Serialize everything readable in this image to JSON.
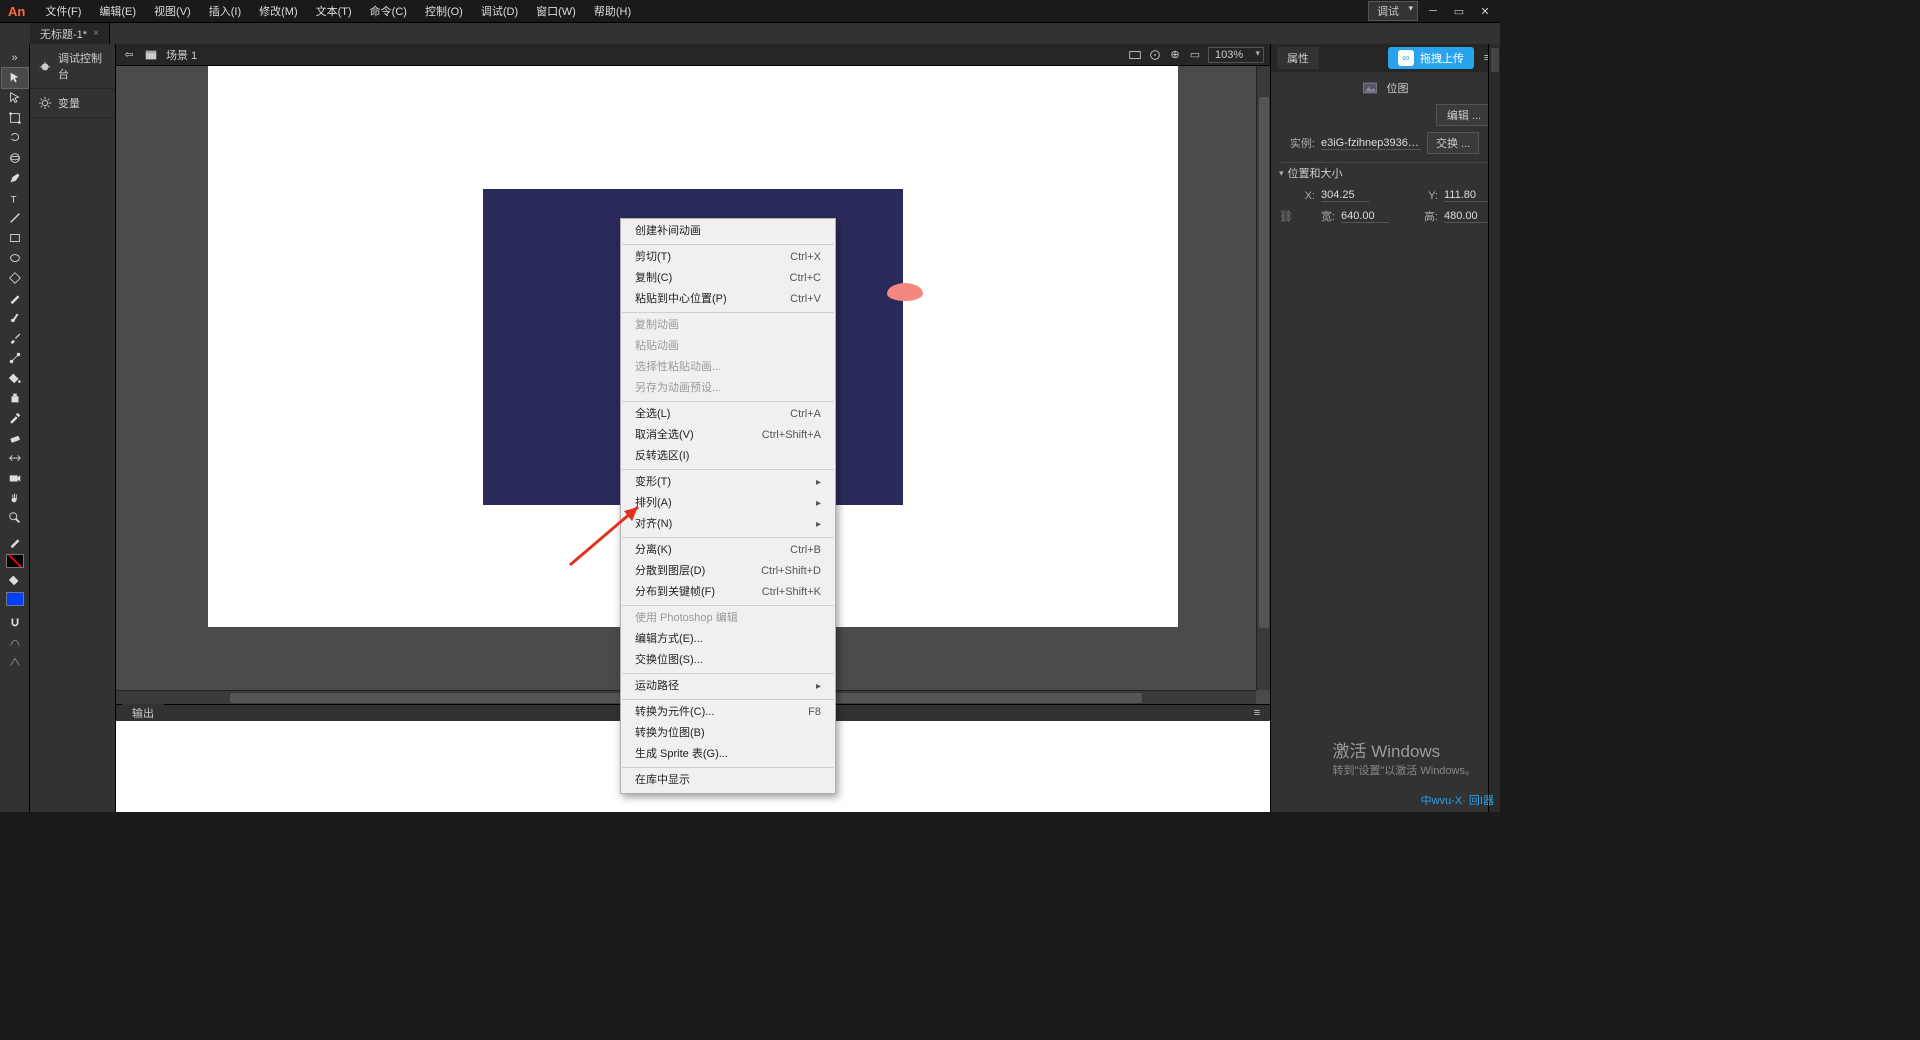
{
  "app": {
    "logo": "An"
  },
  "menus": [
    "文件(F)",
    "编辑(E)",
    "视图(V)",
    "插入(I)",
    "修改(M)",
    "文本(T)",
    "命令(C)",
    "控制(O)",
    "调试(D)",
    "窗口(W)",
    "帮助(H)"
  ],
  "titlebar": {
    "debug_label": "调试"
  },
  "doc_tab": {
    "title": "无标题-1*",
    "close": "×"
  },
  "left_dock": {
    "debug_console": "调试控制台",
    "vars": "变量"
  },
  "scene": {
    "label": "场景 1",
    "zoom": "103%"
  },
  "output": {
    "tab": "输出"
  },
  "context_menu": {
    "create_tween": "创建补间动画",
    "cut": "剪切(T)",
    "cut_sc": "Ctrl+X",
    "copy": "复制(C)",
    "copy_sc": "Ctrl+C",
    "paste_center": "粘贴到中心位置(P)",
    "paste_center_sc": "Ctrl+V",
    "copy_anim": "复制动画",
    "paste_anim": "粘贴动画",
    "paste_anim_sel": "选择性粘贴动画...",
    "save_preset": "另存为动画预设...",
    "select_all": "全选(L)",
    "select_all_sc": "Ctrl+A",
    "deselect": "取消全选(V)",
    "deselect_sc": "Ctrl+Shift+A",
    "invert_sel": "反转选区(I)",
    "transform": "变形(T)",
    "arrange": "排列(A)",
    "align": "对齐(N)",
    "break": "分离(K)",
    "break_sc": "Ctrl+B",
    "dist_layers": "分散到图层(D)",
    "dist_layers_sc": "Ctrl+Shift+D",
    "dist_keys": "分布到关键帧(F)",
    "dist_keys_sc": "Ctrl+Shift+K",
    "edit_ps": "使用 Photoshop 编辑",
    "edit_mode": "编辑方式(E)...",
    "swap_bitmap": "交换位图(S)...",
    "motion_path": "运动路径",
    "convert_symbol": "转换为元件(C)...",
    "convert_symbol_sc": "F8",
    "convert_bitmap": "转换为位图(B)",
    "generate_sprite": "生成 Sprite 表(G)...",
    "show_in_lib": "在库中显示"
  },
  "props": {
    "tab": "属性",
    "upload_btn": "拖拽上传",
    "kind": "位图",
    "edit_btn": "编辑 ...",
    "instance_lbl": "实例:",
    "instance_name": "e3iG-fzihnep39366...",
    "swap_btn": "交换 ...",
    "section_possize": "位置和大小",
    "x_lbl": "X:",
    "x_val": "304.25",
    "y_lbl": "Y:",
    "y_val": "111.80",
    "w_lbl": "宽:",
    "w_val": "640.00",
    "h_lbl": "高:",
    "h_val": "480.00"
  },
  "wm": {
    "t1": "激活 Windows",
    "t2": "转到\"设置\"以激活 Windows。"
  },
  "brand": {
    "txt": "中wvu-X· 回I器"
  },
  "colors": {
    "stage_rect": "#2a2b5a",
    "accent": "#2aa3ef",
    "fill_swatch": "#0040ff"
  }
}
